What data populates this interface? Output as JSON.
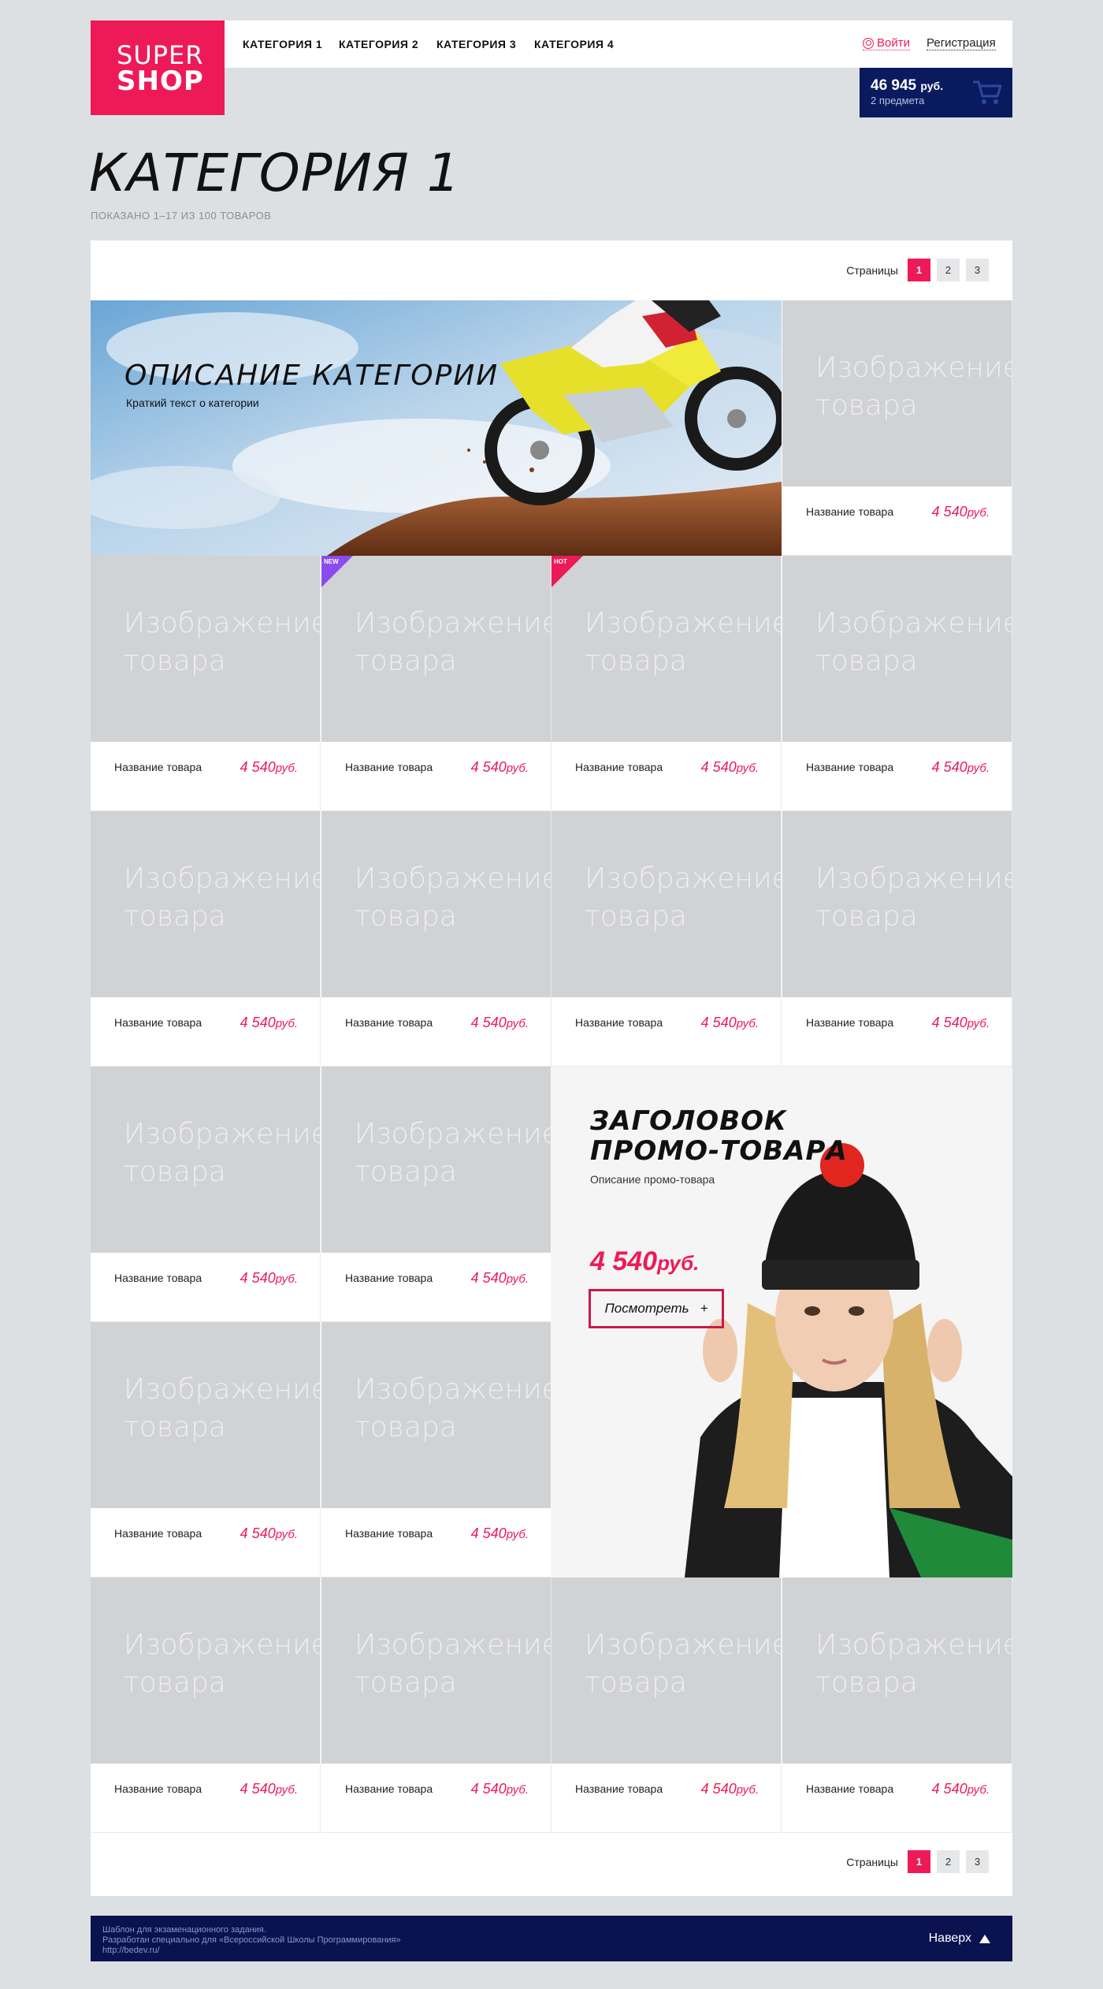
{
  "header": {
    "logo_line1": "SUPER",
    "logo_line2": "SHOP",
    "nav": [
      "КАТЕГОРИЯ 1",
      "КАТЕГОРИЯ 2",
      "КАТЕГОРИЯ 3",
      "КАТЕГОРИЯ 4"
    ],
    "login": "Войти",
    "register": "Регистрация",
    "cart_sum": "46 945",
    "cart_currency": "руб.",
    "cart_count": "2 предмета"
  },
  "page": {
    "title": "КАТЕГОРИЯ 1",
    "subtitle": "ПОКАЗАНО 1–17 ИЗ 100 ТОВАРОВ"
  },
  "pagination": {
    "label": "Страницы",
    "pages": [
      "1",
      "2",
      "3"
    ],
    "active": "1"
  },
  "banner": {
    "heading": "ОПИСАНИЕ КАТЕГОРИИ",
    "text": "Краткий текст о категории"
  },
  "product": {
    "placeholder_line1": "Изображение",
    "placeholder_line2": "товара",
    "name": "Название товара",
    "price": "4 540",
    "currency": "руб."
  },
  "badges": {
    "new": "NEW",
    "hot": "HOT"
  },
  "promo": {
    "heading_line1": "ЗАГОЛОВОК",
    "heading_line2": "ПРОМО-ТОВАРА",
    "description": "Описание промо-товара",
    "price": "4 540",
    "currency": "руб.",
    "button": "Посмотреть",
    "button_icon": "+"
  },
  "footer": {
    "line1": "Шаблон для экзаменационного задания.",
    "line2": "Разработан специально для «Всероссийской Школы Программирования»",
    "line3": "http://bedev.ru/",
    "back_to_top": "Наверх"
  },
  "colors": {
    "accent": "#ee1a58",
    "navy": "#0a1a5e",
    "placeholder_bg": "#d1d2d4",
    "page_bg": "#dde0e3"
  }
}
